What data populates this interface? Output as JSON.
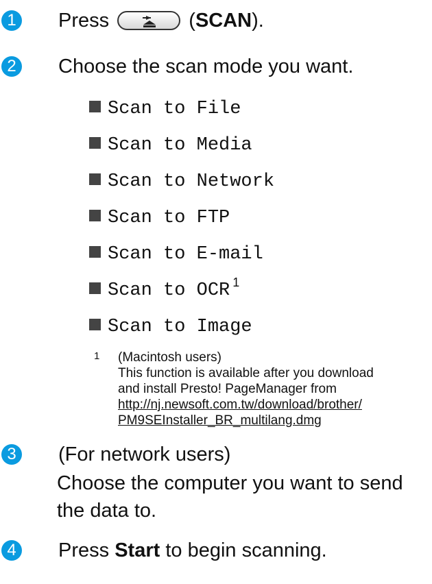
{
  "steps": [
    {
      "num": "1",
      "prefix": "Press",
      "button_icon": "scan-tray-icon",
      "paren_open": "(",
      "bold": "SCAN",
      "suffix": ")."
    },
    {
      "num": "2",
      "text": "Choose the scan mode you want."
    },
    {
      "num": "3",
      "line1": "(For network users)",
      "line2": "Choose the computer you want to send",
      "line3": "the data to."
    },
    {
      "num": "4",
      "prefix": "Press",
      "bold": "Start",
      "suffix": "to begin scanning."
    }
  ],
  "scan_modes": [
    {
      "label": "Scan to File"
    },
    {
      "label": "Scan to Media"
    },
    {
      "label": "Scan to Network"
    },
    {
      "label": "Scan to FTP"
    },
    {
      "label": "Scan to E-mail"
    },
    {
      "label": "Scan to OCR",
      "footnote_ref": "1"
    },
    {
      "label": "Scan to Image"
    }
  ],
  "footnote": {
    "mark": "1",
    "title": "(Macintosh users)",
    "line1": "This function is available after you download",
    "line2": "and install Presto! PageManager from",
    "link_line1": "http://nj.newsoft.com.tw/download/brother/",
    "link_line2": "PM9SEInstaller_BR_multilang.dmg"
  },
  "colors": {
    "step_badge": "#0a9be0",
    "text": "#111111",
    "bullet": "#444444"
  }
}
